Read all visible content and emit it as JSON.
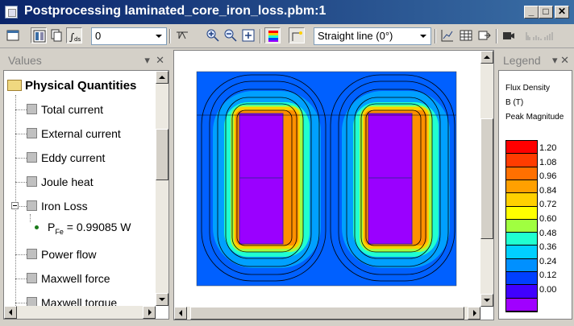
{
  "window": {
    "title": "Postprocessing laminated_core_iron_loss.pbm:1"
  },
  "toolbar": {
    "time_combo_value": "0",
    "cut_combo_value": "Straight line (0°)"
  },
  "values_panel": {
    "header": "Values",
    "root": "Physical Quantities",
    "items": [
      {
        "label": "Total current"
      },
      {
        "label": "External current"
      },
      {
        "label": "Eddy current"
      },
      {
        "label": "Joule heat"
      },
      {
        "label": "Iron Loss"
      },
      {
        "label": "Power flow"
      },
      {
        "label": "Maxwell force"
      },
      {
        "label": "Maxwell torque"
      }
    ],
    "iron_loss_value": {
      "symbol": "P",
      "subscript": "Fe",
      "text": "= 0.99085 W"
    }
  },
  "legend_panel": {
    "header": "Legend",
    "quantity": "Flux Density",
    "unit": "B (T)",
    "mode": "Peak Magnitude",
    "ticks": [
      "1.20",
      "1.08",
      "0.96",
      "0.84",
      "0.72",
      "0.60",
      "0.48",
      "0.36",
      "0.24",
      "0.12",
      "0.00"
    ],
    "colors": [
      "#ff0000",
      "#ff3c00",
      "#ff7000",
      "#ffa000",
      "#ffd000",
      "#ffff00",
      "#a0ff40",
      "#20ffd0",
      "#00d0ff",
      "#0090ff",
      "#0040ff",
      "#4000ff",
      "#a000ff"
    ]
  },
  "colors": {
    "titlebar_start": "#0a246a",
    "titlebar_end": "#3a6ea5",
    "field_background": "#0060ff",
    "coil": "#9a00ff"
  }
}
